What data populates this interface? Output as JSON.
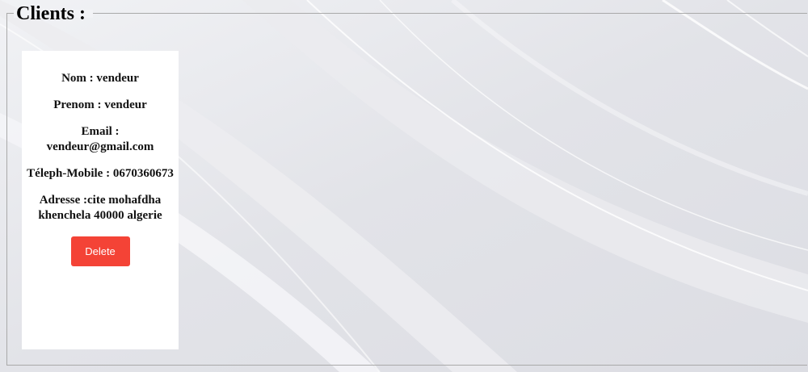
{
  "legend": "Clients :",
  "client": {
    "nom_label": "Nom : ",
    "nom": "vendeur",
    "prenom_label": "Prenom : ",
    "prenom": "vendeur",
    "email_label": "Email : ",
    "email": "vendeur@gmail.com",
    "telephone_label": "Téleph-Mobile : ",
    "telephone": "0670360673",
    "adresse_label": "Adresse :",
    "adresse": "cite mohafdha khenchela 40000 algerie",
    "delete_label": "Delete"
  },
  "colors": {
    "background": "#e4e5ea",
    "card": "#ffffff",
    "delete_button": "#f44336",
    "border": "#a9a9a9"
  }
}
